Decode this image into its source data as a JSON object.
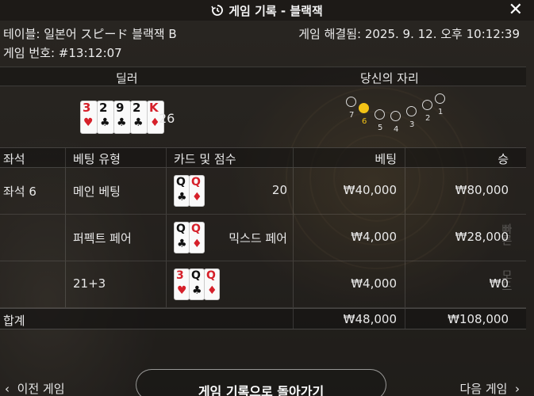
{
  "header": {
    "title": "게임 기록 - 블랙잭",
    "table_name": "테이블: 일본어 スピード 블랙잭 B",
    "settled": "게임 해결됨: 2025. 9. 12. 오후 10:12:39",
    "game_number": "게임 번호: #13:12:07"
  },
  "dealer_section": {
    "dealer_label": "딜러",
    "seat_label": "당신의 자리",
    "dealer_cards": [
      {
        "rank": "3",
        "suit": "♥",
        "color": "red"
      },
      {
        "rank": "2",
        "suit": "♣",
        "color": "black"
      },
      {
        "rank": "9",
        "suit": "♣",
        "color": "black"
      },
      {
        "rank": "2",
        "suit": "♣",
        "color": "black"
      },
      {
        "rank": "K",
        "suit": "♦",
        "color": "red"
      }
    ],
    "dealer_score": "26",
    "seats": [
      "7",
      "6",
      "5",
      "4",
      "3",
      "2",
      "1"
    ],
    "active_seat": "6"
  },
  "table": {
    "headers": {
      "seat": "좌석",
      "bet_type": "베팅 유형",
      "cards": "카드 및 점수",
      "bet": "베팅",
      "win": "승"
    },
    "rows": [
      {
        "seat": "좌석 6",
        "bet_type": "메인 베팅",
        "cards": [
          {
            "rank": "Q",
            "suit": "♣",
            "color": "black"
          },
          {
            "rank": "Q",
            "suit": "♦",
            "color": "red"
          }
        ],
        "score": "20",
        "bet": "₩40,000",
        "win": "₩80,000"
      },
      {
        "seat": "",
        "bet_type": "퍼펙트 페어",
        "cards": [
          {
            "rank": "Q",
            "suit": "♣",
            "color": "black"
          },
          {
            "rank": "Q",
            "suit": "♦",
            "color": "red"
          }
        ],
        "score": "믹스드 페어",
        "bet": "₩4,000",
        "win": "₩28,000"
      },
      {
        "seat": "",
        "bet_type": "21+3",
        "cards": [
          {
            "rank": "3",
            "suit": "♥",
            "color": "red"
          },
          {
            "rank": "Q",
            "suit": "♣",
            "color": "black"
          },
          {
            "rank": "Q",
            "suit": "♦",
            "color": "red"
          }
        ],
        "score": "",
        "bet": "₩4,000",
        "win": "₩0"
      }
    ],
    "total": {
      "label": "합계",
      "bet": "₩48,000",
      "win": "₩108,000"
    }
  },
  "nav": {
    "prev": "이전 게임",
    "back": "게임 기록으로 돌아가기",
    "next": "다음 게임"
  },
  "side_text": [
    "빠른",
    "모드"
  ],
  "colors": {
    "accent": "#f3c316",
    "red_suit": "#d6202a"
  }
}
